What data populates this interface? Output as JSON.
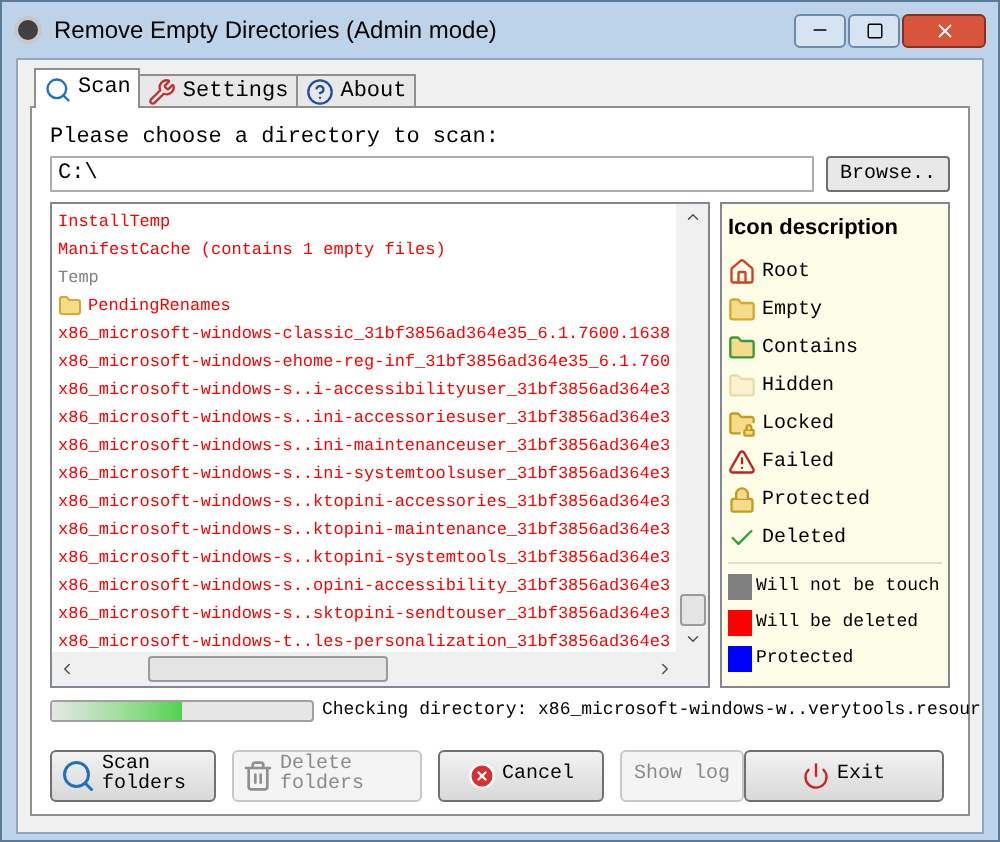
{
  "window": {
    "title": "Remove Empty Directories (Admin mode)"
  },
  "tabs": [
    {
      "label": "Scan",
      "kind": "scan",
      "selected": true
    },
    {
      "label": "Settings",
      "kind": "settings",
      "selected": false
    },
    {
      "label": "About",
      "kind": "about",
      "selected": false
    }
  ],
  "directory": {
    "label": "Please choose a directory to scan:",
    "value": "C:\\",
    "browse": "Browse.."
  },
  "folders": [
    {
      "name": "InstallTemp",
      "color": "#ff0000",
      "kind": "plain"
    },
    {
      "name": "ManifestCache (contains 1 empty files)",
      "color": "#ff0000",
      "kind": "plain"
    },
    {
      "name": "Temp",
      "color": "#808080",
      "kind": "plain"
    },
    {
      "name": "PendingRenames",
      "color": "#ff0000",
      "kind": "folder"
    },
    {
      "name": "x86_microsoft-windows-classic_31bf3856ad364e35_6.1.7600.1638",
      "color": "#ff0000",
      "kind": "plain"
    },
    {
      "name": "x86_microsoft-windows-ehome-reg-inf_31bf3856ad364e35_6.1.760",
      "color": "#ff0000",
      "kind": "plain"
    },
    {
      "name": "x86_microsoft-windows-s..i-accessibilityuser_31bf3856ad364e3",
      "color": "#ff0000",
      "kind": "plain"
    },
    {
      "name": "x86_microsoft-windows-s..ini-accessoriesuser_31bf3856ad364e3",
      "color": "#ff0000",
      "kind": "plain"
    },
    {
      "name": "x86_microsoft-windows-s..ini-maintenanceuser_31bf3856ad364e3",
      "color": "#ff0000",
      "kind": "plain"
    },
    {
      "name": "x86_microsoft-windows-s..ini-systemtoolsuser_31bf3856ad364e3",
      "color": "#ff0000",
      "kind": "plain"
    },
    {
      "name": "x86_microsoft-windows-s..ktopini-accessories_31bf3856ad364e3",
      "color": "#ff0000",
      "kind": "plain"
    },
    {
      "name": "x86_microsoft-windows-s..ktopini-maintenance_31bf3856ad364e3",
      "color": "#ff0000",
      "kind": "plain"
    },
    {
      "name": "x86_microsoft-windows-s..ktopini-systemtools_31bf3856ad364e3",
      "color": "#ff0000",
      "kind": "plain"
    },
    {
      "name": "x86_microsoft-windows-s..opini-accessibility_31bf3856ad364e3",
      "color": "#ff0000",
      "kind": "plain"
    },
    {
      "name": "x86_microsoft-windows-s..sktopini-sendtouser_31bf3856ad364e3",
      "color": "#ff0000",
      "kind": "plain"
    },
    {
      "name": "x86_microsoft-windows-t..les-personalization_31bf3856ad364e3",
      "color": "#ff0000",
      "kind": "plain"
    }
  ],
  "legend": {
    "title": "Icon description",
    "icons": [
      {
        "label": "Root",
        "kind": "root"
      },
      {
        "label": "Empty",
        "kind": "empty"
      },
      {
        "label": "Contains",
        "kind": "contains"
      },
      {
        "label": "Hidden",
        "kind": "hidden"
      },
      {
        "label": "Locked",
        "kind": "locked"
      },
      {
        "label": "Failed",
        "kind": "failed"
      },
      {
        "label": "Protected",
        "kind": "protected"
      },
      {
        "label": "Deleted",
        "kind": "deleted"
      }
    ],
    "colors": [
      {
        "label": "Will not be touch",
        "color": "#808080"
      },
      {
        "label": "Will be deleted",
        "color": "#ff0000"
      },
      {
        "label": "Protected",
        "color": "#0000ff"
      }
    ]
  },
  "progress": {
    "level": 0.5
  },
  "status": "Checking directory: x86_microsoft-windows-w..verytools.resour",
  "buttons": [
    {
      "label": "Scan folders",
      "kind": "scan",
      "disabled": false
    },
    {
      "label": "Delete folders",
      "kind": "delete",
      "disabled": true
    },
    {
      "label": "Cancel",
      "kind": "cancel",
      "disabled": false
    },
    {
      "label": "Show log",
      "kind": "log",
      "disabled": true
    },
    {
      "label": "Exit",
      "kind": "exit",
      "disabled": false
    }
  ]
}
